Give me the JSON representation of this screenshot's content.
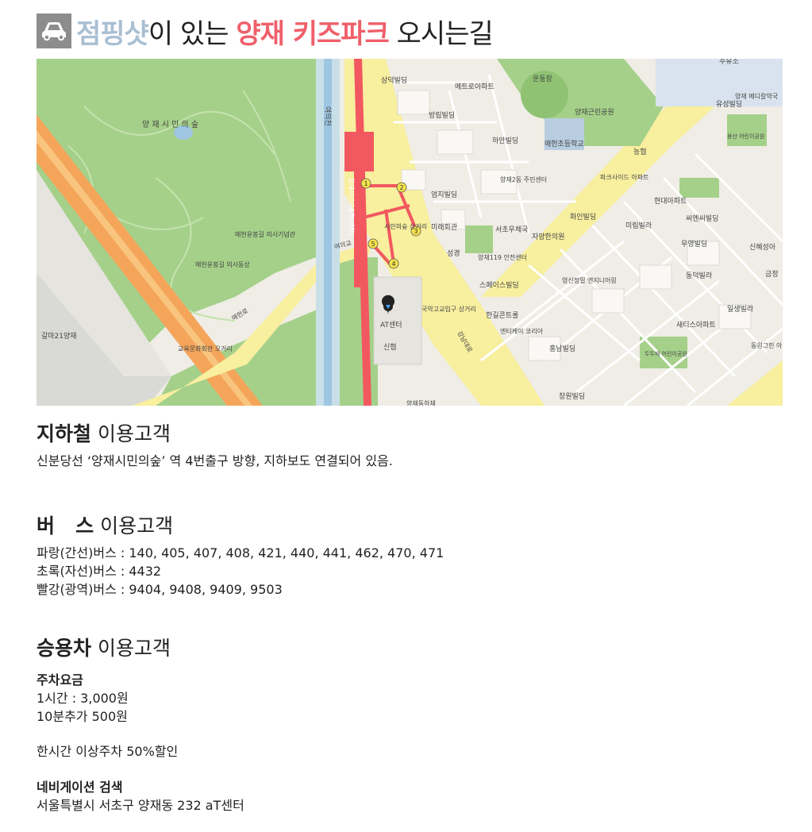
{
  "title": {
    "brand": "점핑샷",
    "mid": "이 있는 ",
    "place": "양재 키즈파크",
    "tail": " 오시는길",
    "icon": "car-icon",
    "colors": {
      "brand": "#a9bfd2",
      "place": "#ef5f6a",
      "badge": "#8d8d8d"
    }
  },
  "map": {
    "labels": {
      "park": "양 재 시 민 의 숲",
      "yeouicheon": "여의천",
      "stream_road": "양재시민의숲역(매헌)",
      "yeouigyo": "여의교",
      "maeheon_ro": "매헌로",
      "samdeok": "삼덕빌딩",
      "metro_apt": "메트로아파트",
      "sports": "운동장",
      "yangjae_park": "양재근린공원",
      "juyuso": "주유소",
      "yangjae_medical": "양재 메디칼약국",
      "yuseong": "유성빌딩",
      "yongsan_kinder": "용산 어린이공원",
      "bangrim": "방림빌딩",
      "haan": "하안빌딩",
      "maeheon_school": "매헌초등학교",
      "nonghyup": "농협",
      "parkside": "파크사이드 아파트",
      "hyundai_apt": "현대아파트",
      "yangjae2": "양재2동 주민센터",
      "eomji": "엄지빌딩",
      "miraehall": "미래회관",
      "seocho_tax": "서초우체국",
      "hwain": "화인빌딩",
      "mirim": "미림빌라",
      "mnc": "씨엔씨빌딩",
      "yangjae119": "양재119 안전센터",
      "jayang": "자양한의원",
      "yuyeong": "우영빌딩",
      "shinhye": "신혜성아",
      "geumjeong": "금정",
      "dongdeok": "동덕빌라",
      "seonggyeong": "성경",
      "space": "스페이스빌딩",
      "yeongsin": "영신정밀 엔지니어링",
      "simin_arcade": "시민의숲 상거리",
      "maeheon_memorial": "매헌윤봉길 의사기념관",
      "maeheon_statue": "매헌윤봉길 의사동상",
      "at_center": "AT센터",
      "shinhyup": "신협",
      "gugak": "국악고교입구 상거리",
      "gangnam_ro": "강남대로",
      "hangil": "한길콘트롤",
      "entikei": "엔티케이 코리아",
      "hongnam": "홍남빌딩",
      "ilsaeng": "일생빌라",
      "saetis": "새티스아파트",
      "dongwon": "동원그린 아파트",
      "dudukje": "두두재 어린이공원",
      "galma": "갈마21양재",
      "education": "교육문화회관 오거리",
      "changwon": "창원빌딩",
      "yangjae_dongha": "양재동하체",
      "exits": [
        "1",
        "2",
        "3",
        "4",
        "5"
      ]
    },
    "colors": {
      "park": "#a5d08a",
      "road_main": "#f8ef9f",
      "highway": "#f4a55a",
      "subway": "#f2585f",
      "stream": "#9ec5e2",
      "block": "#f5f4ef",
      "exit": "#f5e34c"
    }
  },
  "subway": {
    "heading": "지하철",
    "suffix": " 이용고객",
    "text": "신분당선 ‘양재시민의숲’ 역 4번출구 방향, 지하보도 연결되어 있음."
  },
  "bus": {
    "heading": "버   스",
    "suffix": " 이용고객",
    "lines": [
      "파랑(간선)버스 : 140, 405, 407, 408, 421, 440, 441, 462, 470, 471",
      "초록(자선)버스 : 4432",
      "빨강(광역)버스 : 9404, 9408, 9409, 9503"
    ]
  },
  "car": {
    "heading": "승용차",
    "suffix": " 이용고객",
    "fee_title": "주차요금",
    "fee_lines": [
      "1시간 : 3,000원",
      "10분추가 500원"
    ],
    "discount": "한시간 이상주차 50%할인",
    "nav_title": "네비게이션 검색",
    "nav_address": "서울특별시 서초구 양재동 232 aT센터"
  }
}
